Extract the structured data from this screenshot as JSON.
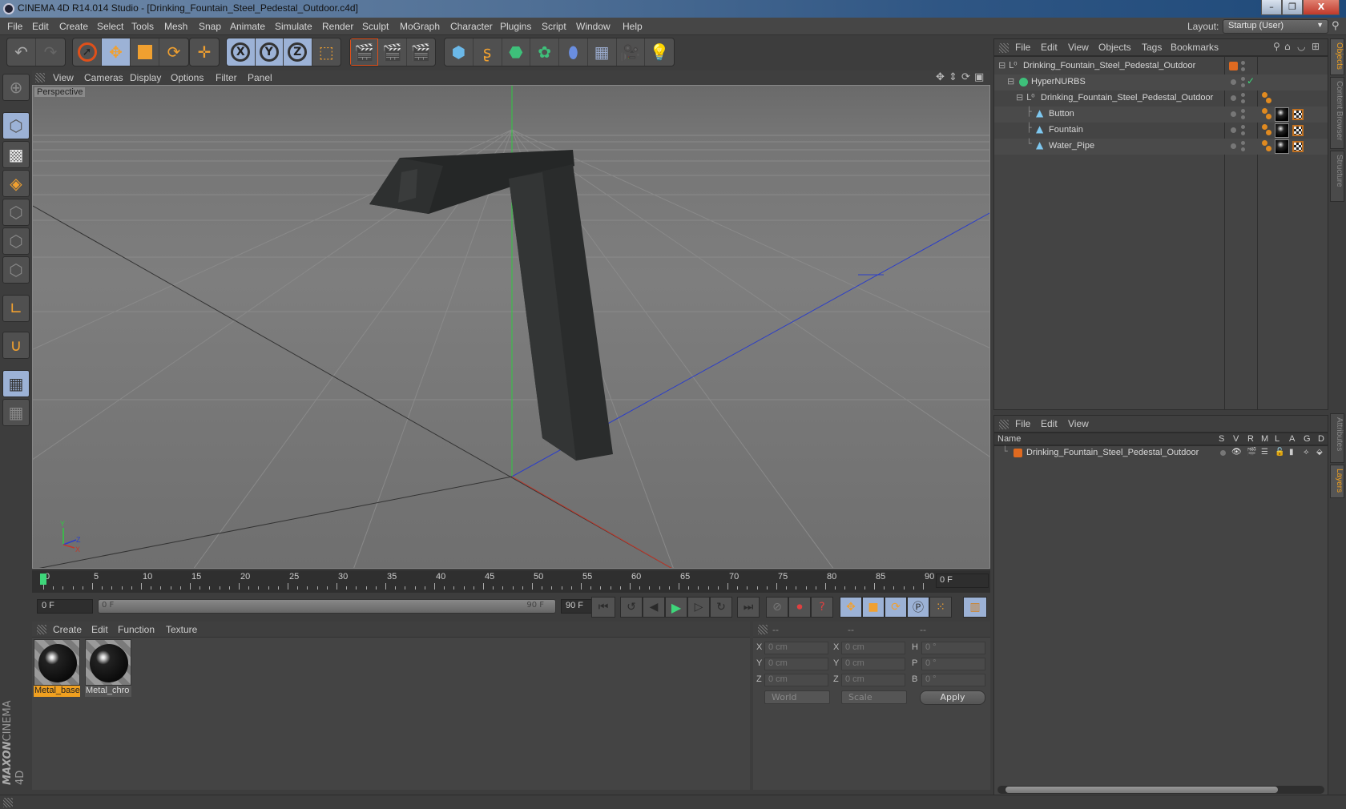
{
  "window": {
    "title": "CINEMA 4D R14.014 Studio - [Drinking_Fountain_Steel_Pedestal_Outdoor.c4d]",
    "minimize": "–",
    "restore": "❐",
    "close": "X"
  },
  "menubar": {
    "items": [
      "File",
      "Edit",
      "Create",
      "Select",
      "Tools",
      "Mesh",
      "Snap",
      "Animate",
      "Simulate",
      "Render",
      "Sculpt",
      "MoGraph",
      "Character",
      "Plugins",
      "Script",
      "Window",
      "Help"
    ],
    "layout_label": "Layout:",
    "layout_value": "Startup (User)"
  },
  "toolbar": {
    "groups": [
      [
        "undo-icon",
        "redo-icon"
      ],
      [
        "live-selection-icon",
        "move-icon",
        "scale-icon",
        "rotate-icon"
      ],
      [
        "recent-tool-icon"
      ],
      [
        "x-axis-lock-icon",
        "y-axis-lock-icon",
        "z-axis-lock-icon",
        "coordinate-system-icon"
      ],
      [
        "render-view-icon",
        "render-picture-viewer-icon",
        "render-settings-icon"
      ],
      [
        "cube-icon",
        "spline-pen-icon",
        "nurbs-icon",
        "array-icon",
        "deformer-icon",
        "floor-icon",
        "camera-icon",
        "light-icon"
      ]
    ],
    "axis_labels": [
      "X",
      "Y",
      "Z"
    ]
  },
  "left_toolbar": [
    "make-editable-icon",
    "model-mode-icon",
    "texture-mode-icon",
    "workplane-mode-icon",
    "points-mode-icon",
    "edges-mode-icon",
    "polygons-mode-icon",
    "axis-mode-icon",
    "snap-magnet-icon",
    "lock-workplane-icon",
    "workplane-align-icon"
  ],
  "viewport": {
    "menu": [
      "View",
      "Cameras",
      "Display",
      "Options",
      "Filter",
      "Panel"
    ],
    "label": "Perspective",
    "nav_icons": [
      "move-view-icon",
      "zoom-view-icon",
      "rotate-view-icon",
      "maximize-view-icon"
    ],
    "axis_gizmo": {
      "x": "X",
      "y": "Y",
      "z": "Z"
    }
  },
  "timeline": {
    "ticks": [
      "0",
      "5",
      "10",
      "15",
      "20",
      "25",
      "30",
      "35",
      "40",
      "45",
      "50",
      "55",
      "60",
      "65",
      "70",
      "75",
      "80",
      "85",
      "90"
    ],
    "current_frame": "0 F",
    "start_field": "0 F",
    "range_start": "0 F",
    "range_end": "90 F",
    "end_field": "90 F",
    "range_fraction": 1.0
  },
  "transport": {
    "buttons": [
      "go-to-start-icon",
      "previous-key-icon",
      "previous-frame-icon",
      "play-icon",
      "next-frame-icon",
      "next-key-icon",
      "go-to-end-icon"
    ],
    "key_buttons": [
      "autokey-disabled-icon",
      "record-keys-icon",
      "keyframe-selection-icon"
    ],
    "track_buttons": [
      "move-track-icon",
      "scale-track-icon",
      "rotate-track-icon",
      "parameter-track-icon",
      "point-level-icon"
    ],
    "timeline_window": "film-strip-icon"
  },
  "material_manager": {
    "menu": [
      "Create",
      "Edit",
      "Function",
      "Texture"
    ],
    "materials": [
      {
        "name": "Metal_base",
        "selected": true
      },
      {
        "name": "Metal_chro",
        "selected": false
      }
    ]
  },
  "coordinates": {
    "headers": [
      "--",
      "--",
      "--"
    ],
    "rows": [
      {
        "l1": "X",
        "v1": "0 cm",
        "l2": "X",
        "v2": "0 cm",
        "l3": "H",
        "v3": "0 °"
      },
      {
        "l1": "Y",
        "v1": "0 cm",
        "l2": "Y",
        "v2": "0 cm",
        "l3": "P",
        "v3": "0 °"
      },
      {
        "l1": "Z",
        "v1": "0 cm",
        "l2": "Z",
        "v2": "0 cm",
        "l3": "B",
        "v3": "0 °"
      }
    ],
    "space": "World",
    "mode": "Scale",
    "apply": "Apply"
  },
  "object_manager": {
    "menu": [
      "File",
      "Edit",
      "View",
      "Objects",
      "Tags",
      "Bookmarks"
    ],
    "objects": [
      {
        "name": "Drinking_Fountain_Steel_Pedestal_Outdoor",
        "type": "null",
        "depth": 0,
        "tags": []
      },
      {
        "name": "HyperNURBS",
        "type": "hypernurbs",
        "depth": 1,
        "tags": [],
        "enabled": true
      },
      {
        "name": "Drinking_Fountain_Steel_Pedestal_Outdoor",
        "type": "null",
        "depth": 2,
        "tags": [
          "phong"
        ]
      },
      {
        "name": "Button",
        "type": "polygon",
        "depth": 3,
        "tags": [
          "phong",
          "material",
          "uvw"
        ]
      },
      {
        "name": "Fountain",
        "type": "polygon",
        "depth": 3,
        "tags": [
          "phong",
          "material",
          "uvw"
        ]
      },
      {
        "name": "Water_Pipe",
        "type": "polygon",
        "depth": 3,
        "tags": [
          "phong",
          "material",
          "uvw"
        ]
      }
    ],
    "layer_color": "#e06a20"
  },
  "layer_manager": {
    "menu": [
      "File",
      "Edit",
      "View"
    ],
    "columns": [
      "Name",
      "S",
      "V",
      "R",
      "M",
      "L",
      "A",
      "G",
      "D"
    ],
    "layers": [
      {
        "name": "Drinking_Fountain_Steel_Pedestal_Outdoor",
        "color": "#e06a20"
      }
    ]
  },
  "side_tabs": {
    "top": [
      {
        "label": "Objects",
        "active": true
      },
      {
        "label": "Content Browser",
        "active": false
      },
      {
        "label": "Structure",
        "active": false
      }
    ],
    "bottom": [
      {
        "label": "Attributes",
        "active": false
      },
      {
        "label": "Layers",
        "active": true
      }
    ]
  },
  "branding": {
    "maxon": "MAXON",
    "product": "CINEMA 4D"
  },
  "colors": {
    "accent": "#f0a020",
    "selected_tool": "#9cb2d6",
    "play_green": "#3ed67a",
    "x_axis": "#c0392b",
    "y_axis": "#2ecc40",
    "z_axis": "#2c3ec8"
  }
}
